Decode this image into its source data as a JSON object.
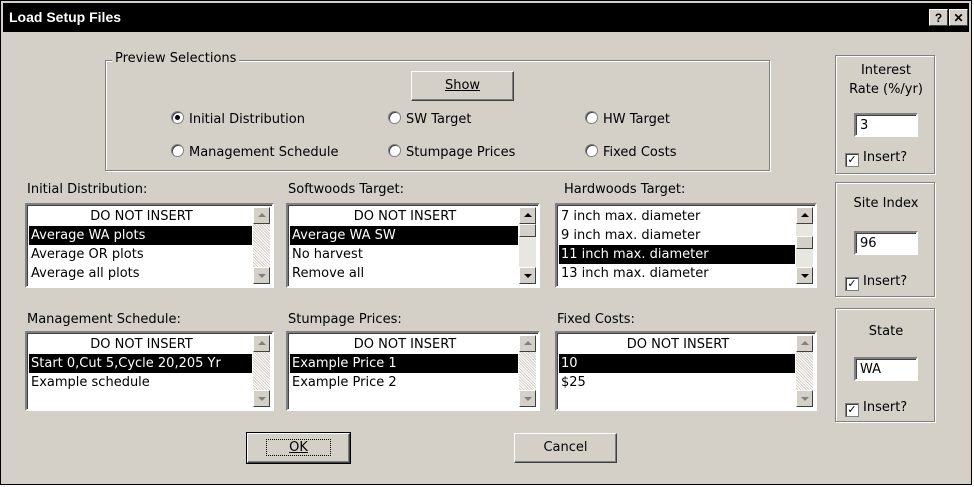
{
  "window": {
    "title": "Load Setup Files",
    "help_btn": "?",
    "close_btn": "✕"
  },
  "preview": {
    "legend": "Preview Selections",
    "show_label": "Show",
    "options": [
      {
        "label": "Initial Distribution",
        "selected": true
      },
      {
        "label": "SW Target",
        "selected": false
      },
      {
        "label": "HW Target",
        "selected": false
      },
      {
        "label": "Management Schedule",
        "selected": false
      },
      {
        "label": "Stumpage Prices",
        "selected": false
      },
      {
        "label": "Fixed Costs",
        "selected": false
      }
    ]
  },
  "lists": {
    "initial_distribution": {
      "label": "Initial Distribution:",
      "items": [
        "DO NOT INSERT",
        "Average WA plots",
        "Average OR plots",
        "Average all plots"
      ],
      "selected": 1
    },
    "softwoods_target": {
      "label": "Softwoods Target:",
      "items": [
        "DO NOT INSERT",
        "Average WA SW",
        "No harvest",
        "Remove all"
      ],
      "selected": 1
    },
    "hardwoods_target": {
      "label": "Hardwoods Target:",
      "items": [
        "7 inch max. diameter",
        "9 inch max. diameter",
        "11 inch max. diameter",
        "13 inch max. diameter"
      ],
      "selected": 2
    },
    "management_schedule": {
      "label": "Management Schedule:",
      "items": [
        "DO NOT INSERT",
        "Start 0,Cut 5,Cycle 20,205 Yr",
        "Example schedule"
      ],
      "selected": 1
    },
    "stumpage_prices": {
      "label": "Stumpage Prices:",
      "items": [
        "DO NOT INSERT",
        "Example Price 1",
        "Example Price 2"
      ],
      "selected": 1
    },
    "fixed_costs": {
      "label": "Fixed Costs:",
      "items": [
        "DO NOT INSERT",
        "10",
        "$25"
      ],
      "selected": 1
    }
  },
  "side": {
    "interest": {
      "label_line1": "Interest",
      "label_line2": "Rate (%/yr)",
      "value": "3",
      "insert_label": "Insert?",
      "checked": true
    },
    "site_index": {
      "label": "Site Index",
      "value": "96",
      "insert_label": "Insert?",
      "checked": true
    },
    "state": {
      "label": "State",
      "value": "WA",
      "insert_label": "Insert?",
      "checked": true
    }
  },
  "buttons": {
    "ok_label": "OK",
    "cancel_label": "Cancel"
  },
  "colors": {
    "face": "#d4d0c8",
    "titlebar": "#000000",
    "selection": "#000000"
  }
}
